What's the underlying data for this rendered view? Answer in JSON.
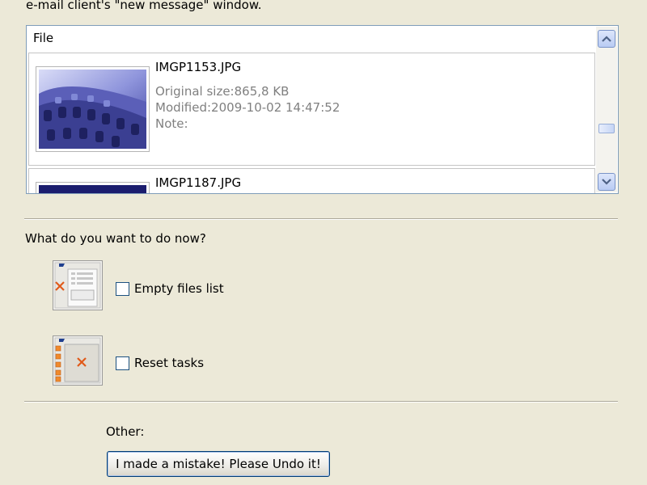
{
  "window": {
    "caption": "e-mail client's \"new message\" window."
  },
  "file_list": {
    "header": "File",
    "items": [
      {
        "name": "IMGP1153.JPG",
        "original_size": "Original size:865,8 KB",
        "modified": "Modified:2009-10-02 14:47:52",
        "note": "Note:"
      },
      {
        "name": "IMGP1187.JPG"
      }
    ]
  },
  "tasks": {
    "question": "What do you want to do now?",
    "empty_files_list": {
      "label": "Empty files list",
      "checked": false,
      "icon": "empty-list-icon"
    },
    "reset_tasks": {
      "label": "Reset tasks",
      "checked": false,
      "icon": "reset-tasks-icon"
    }
  },
  "other": {
    "label": "Other:",
    "undo_button": "I made a mistake! Please Undo it!"
  },
  "colors": {
    "background": "#ece9d8",
    "list_border": "#7f9db9",
    "meta_text": "#808080",
    "icon_accent": "#e05a1a"
  }
}
